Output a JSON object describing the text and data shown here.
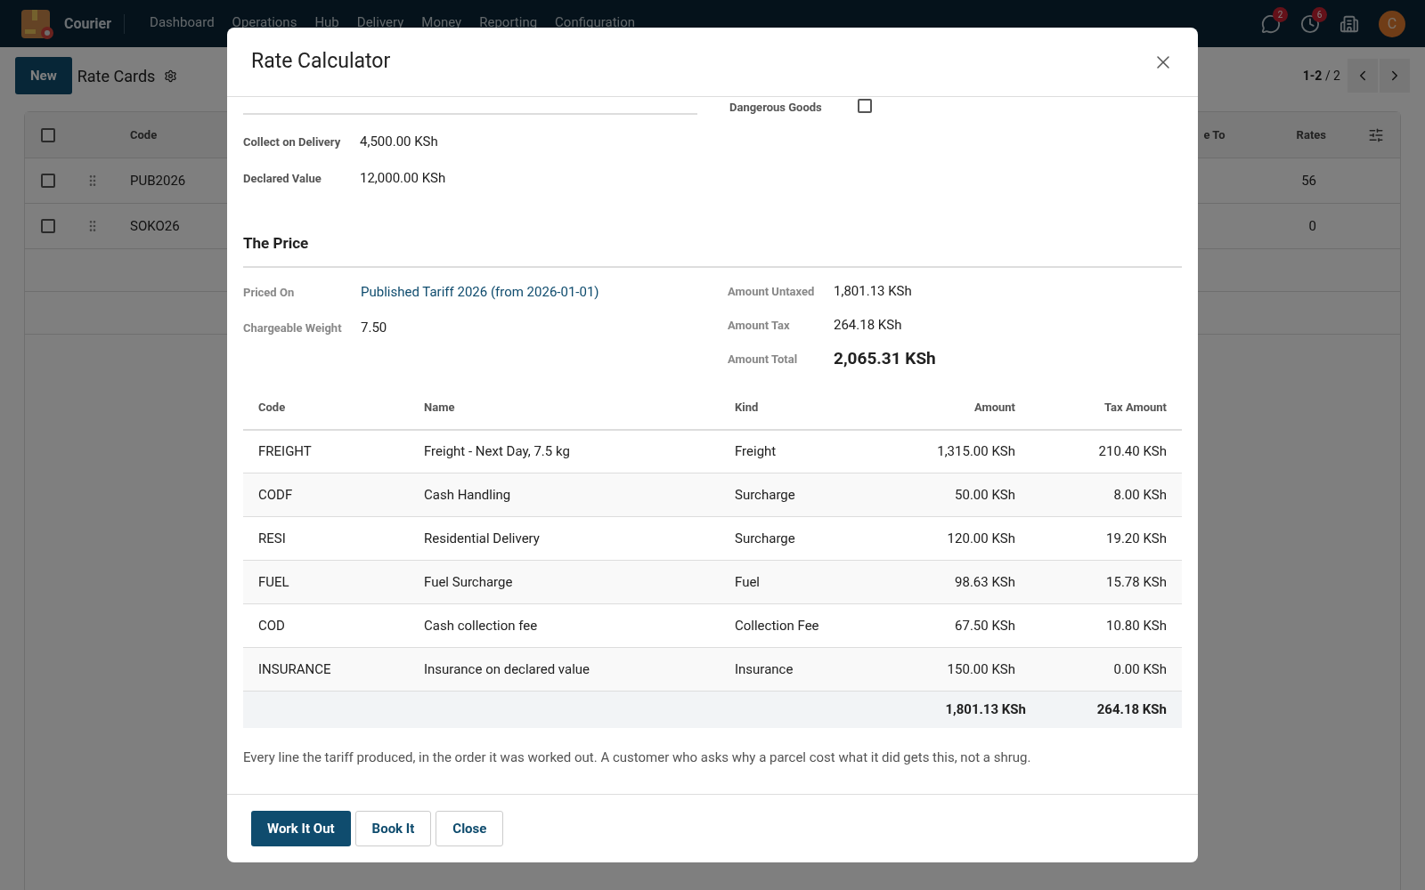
{
  "navbar": {
    "app_name": "Courier",
    "menu": [
      "Dashboard",
      "Operations",
      "Hub",
      "Delivery",
      "Money",
      "Reporting",
      "Configuration"
    ],
    "messages_badge": "2",
    "activities_badge": "6",
    "avatar_initial": "C"
  },
  "control_panel": {
    "new_button": "New",
    "title": "Rate Cards",
    "pager": {
      "range": "1-2",
      "total": "/ 2"
    }
  },
  "list": {
    "all_selected": false,
    "columns": [
      "Code",
      "e To",
      "Rates"
    ],
    "rows": [
      {
        "selected": false,
        "code": "PUB2026",
        "rates": "56"
      },
      {
        "selected": false,
        "code": "SOKO26",
        "rates": "0"
      }
    ]
  },
  "dialog": {
    "title": "Rate Calculator",
    "dangerous_goods": {
      "label": "Dangerous Goods",
      "checked": false
    },
    "fields": [
      {
        "label": "Collect on Delivery",
        "value": "4,500.00 KSh"
      },
      {
        "label": "Declared Value",
        "value": "12,000.00 KSh"
      }
    ],
    "section_title": "The Price",
    "left_fields": [
      {
        "label": "Priced On",
        "value": "Published Tariff 2026 (from 2026-01-01)",
        "kind": "link"
      },
      {
        "label": "Chargeable Weight",
        "value": "7.50",
        "kind": "text"
      }
    ],
    "right_fields": [
      {
        "label": "Amount Untaxed",
        "value": "1,801.13 KSh",
        "kind": "text"
      },
      {
        "label": "Amount Tax",
        "value": "264.18 KSh",
        "kind": "text"
      },
      {
        "label": "Amount Total",
        "value": "2,065.31 KSh",
        "kind": "total"
      }
    ],
    "lines": {
      "columns": [
        "Code",
        "Name",
        "Kind",
        "Amount",
        "Tax Amount"
      ],
      "rows": [
        {
          "code": "FREIGHT",
          "name": "Freight - Next Day, 7.5 kg",
          "kind": "Freight",
          "amount": "1,315.00 KSh",
          "tax": "210.40 KSh"
        },
        {
          "code": "CODF",
          "name": "Cash Handling",
          "kind": "Surcharge",
          "amount": "50.00 KSh",
          "tax": "8.00 KSh"
        },
        {
          "code": "RESI",
          "name": "Residential Delivery",
          "kind": "Surcharge",
          "amount": "120.00 KSh",
          "tax": "19.20 KSh"
        },
        {
          "code": "FUEL",
          "name": "Fuel Surcharge",
          "kind": "Fuel",
          "amount": "98.63 KSh",
          "tax": "15.78 KSh"
        },
        {
          "code": "COD",
          "name": "Cash collection fee",
          "kind": "Collection Fee",
          "amount": "67.50 KSh",
          "tax": "10.80 KSh"
        },
        {
          "code": "INSURANCE",
          "name": "Insurance on declared value",
          "kind": "Insurance",
          "amount": "150.00 KSh",
          "tax": "0.00 KSh"
        }
      ],
      "total_amount": "1,801.13 KSh",
      "total_tax": "264.18 KSh"
    },
    "note": "Every line the tariff produced, in the order it was worked out. A customer who asks why a parcel cost what it did gets this, not a shrug.",
    "buttons": [
      {
        "label": "Work It Out",
        "primary": true
      },
      {
        "label": "Book It",
        "primary": false
      },
      {
        "label": "Close",
        "primary": false
      }
    ]
  }
}
